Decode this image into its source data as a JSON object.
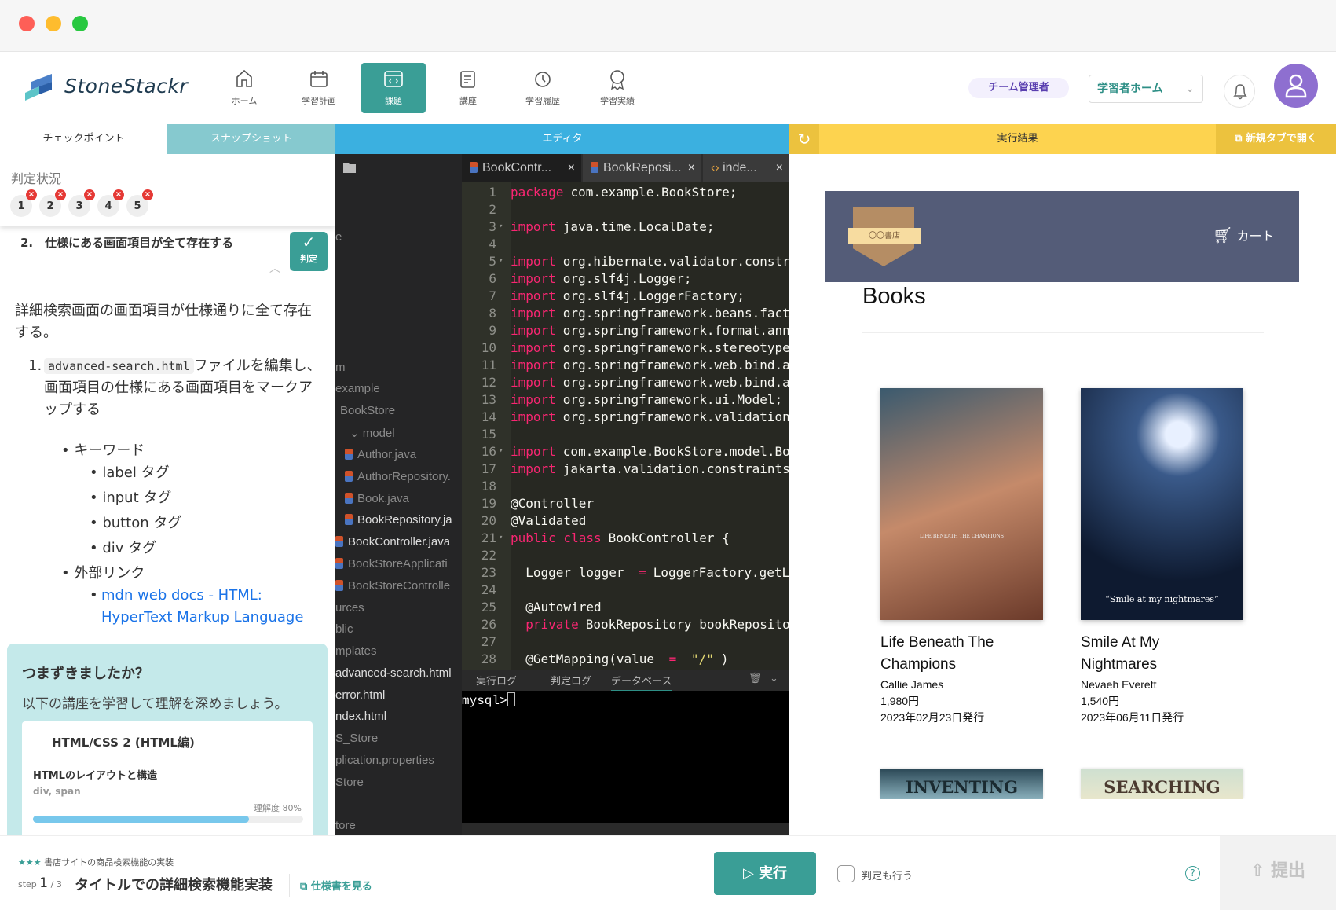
{
  "app": {
    "brand": "StoneStackr",
    "accent": "#3a9e96"
  },
  "nav": [
    {
      "label": "ホーム",
      "icon": "home-icon"
    },
    {
      "label": "学習計画",
      "icon": "calendar-icon"
    },
    {
      "label": "課題",
      "icon": "code-window-icon",
      "active": true
    },
    {
      "label": "講座",
      "icon": "notebook-icon"
    },
    {
      "label": "学習履歴",
      "icon": "history-icon"
    },
    {
      "label": "学習実績",
      "icon": "award-icon"
    }
  ],
  "header": {
    "role_badge": "チーム管理者",
    "home_select": "学習者ホーム"
  },
  "panels": {
    "checkpoint": "チェックポイント",
    "snapshot": "スナップショット",
    "editor": "エディタ",
    "result": "実行結果",
    "open_new_tab": "新規タブで開く"
  },
  "checkpoint": {
    "status_label": "判定状況",
    "checks": [
      "1",
      "2",
      "3",
      "4",
      "5"
    ],
    "item_title": "2.　仕様にある画面項目が全て存在する",
    "judge_button": "判定",
    "description": "詳細検索画面の画面項目が仕様通りに全て存在する。",
    "step_num": "1.",
    "step_code": "advanced-search.html",
    "step_text": "ファイルを編集し、画面項目の仕様にある画面項目をマークアップする",
    "keyword_label": "キーワード",
    "keywords": [
      "label タグ",
      "input タグ",
      "button タグ",
      "div タグ"
    ],
    "external_label": "外部リンク",
    "external_link": "mdn web docs - HTML: HyperText Markup Language"
  },
  "help": {
    "title": "つまずきましたか？",
    "text": "以下の講座を学習して理解を深めましょう。",
    "course": "HTML/CSS 2 (HTML編)",
    "lesson": "HTMLのレイアウトと構造",
    "tags": "div, span",
    "understanding_label": "理解度 80%",
    "understanding": 80
  },
  "tree": {
    "items": [
      "e",
      "m",
      "example",
      "BookStore",
      "model",
      "Author.java",
      "AuthorRepository.",
      "Book.java",
      "BookRepository.ja",
      "BookController.java",
      "BookStoreApplicati",
      "BookStoreControlle",
      "urces",
      "blic",
      "mplates",
      "advanced-search.html",
      "error.html",
      "ndex.html",
      "S_Store",
      "plication.properties",
      "Store",
      "tore"
    ]
  },
  "tabs": [
    {
      "label": "BookContr...",
      "active": true
    },
    {
      "label": "BookReposi..."
    },
    {
      "label": "inde..."
    }
  ],
  "code": [
    [
      [
        "kw",
        "package"
      ],
      [
        "",
        "com.example.BookStore;"
      ]
    ],
    [],
    [
      [
        "kw",
        "import"
      ],
      [
        "",
        "java.time.LocalDate;"
      ]
    ],
    [],
    [
      [
        "kw",
        "import"
      ],
      [
        "",
        "org.hibernate.validator.constr"
      ]
    ],
    [
      [
        "kw",
        "import"
      ],
      [
        "",
        "org.slf4j.Logger;"
      ]
    ],
    [
      [
        "kw",
        "import"
      ],
      [
        "",
        "org.slf4j.LoggerFactory;"
      ]
    ],
    [
      [
        "kw",
        "import"
      ],
      [
        "",
        "org.springframework.beans.fact"
      ]
    ],
    [
      [
        "kw",
        "import"
      ],
      [
        "",
        "org.springframework.format.ann"
      ]
    ],
    [
      [
        "kw",
        "import"
      ],
      [
        "",
        "org.springframework.stereotype"
      ]
    ],
    [
      [
        "kw",
        "import"
      ],
      [
        "",
        "org.springframework.web.bind.a"
      ]
    ],
    [
      [
        "kw",
        "import"
      ],
      [
        "",
        "org.springframework.web.bind.a"
      ]
    ],
    [
      [
        "kw",
        "import"
      ],
      [
        "",
        "org.springframework.ui.Model;"
      ]
    ],
    [
      [
        "kw",
        "import"
      ],
      [
        "",
        "org.springframework.validation"
      ]
    ],
    [],
    [
      [
        "kw",
        "import"
      ],
      [
        "",
        "com.example.BookStore.model.Bo"
      ]
    ],
    [
      [
        "kw",
        "import"
      ],
      [
        "",
        "jakarta.validation.constraints"
      ]
    ],
    [],
    [
      [
        "",
        "@Controller"
      ]
    ],
    [
      [
        "",
        "@Validated"
      ]
    ],
    [
      [
        "kw",
        "public class"
      ],
      [
        "",
        "BookController {"
      ]
    ],
    [],
    [
      [
        "",
        "  Logger logger "
      ],
      [
        "kw",
        "="
      ],
      [
        "",
        "LoggerFactory.getLo"
      ]
    ],
    [],
    [
      [
        "",
        "  @Autowired"
      ]
    ],
    [
      [
        "kw",
        "  private"
      ],
      [
        "",
        "BookRepository bookReposito"
      ]
    ],
    [],
    [
      [
        "",
        "  @GetMapping(value "
      ],
      [
        "kw",
        "="
      ],
      [
        "str",
        " \"/\""
      ],
      [
        "",
        ")"
      ]
    ]
  ],
  "fold_lines": [
    3,
    5,
    16,
    21
  ],
  "console": {
    "tabs": [
      "実行ログ",
      "判定ログ",
      "データベース"
    ],
    "active": 2,
    "prompt": "mysql>"
  },
  "store": {
    "logo_text": "〇〇書店",
    "cart": "カート",
    "heading": "Books",
    "books": [
      {
        "title": "Life Beneath The Champions",
        "author": "Callie James",
        "price": "1,980円",
        "date": "2023年02月23日発行",
        "cover_text": "LIFE BENEATH THE CHAMPIONS"
      },
      {
        "title": "Smile At My Nightmares",
        "author": "Nevaeh Everett",
        "price": "1,540円",
        "date": "2023年06月11日発行",
        "cover_text": "“Smile at my nightmares”"
      },
      {
        "cover_text": "INVENTING"
      },
      {
        "cover_text": "SEARCHING"
      }
    ]
  },
  "footer": {
    "stars": "★★★",
    "course": "書店サイトの商品検索機能の実装",
    "step_label": "step",
    "step": "1",
    "step_total": "/ 3",
    "task_title": "タイトルでの詳細検索機能実装",
    "spec_link": "仕様書を見る",
    "run": "実行",
    "judge_too": "判定も行う",
    "submit": "提出"
  }
}
